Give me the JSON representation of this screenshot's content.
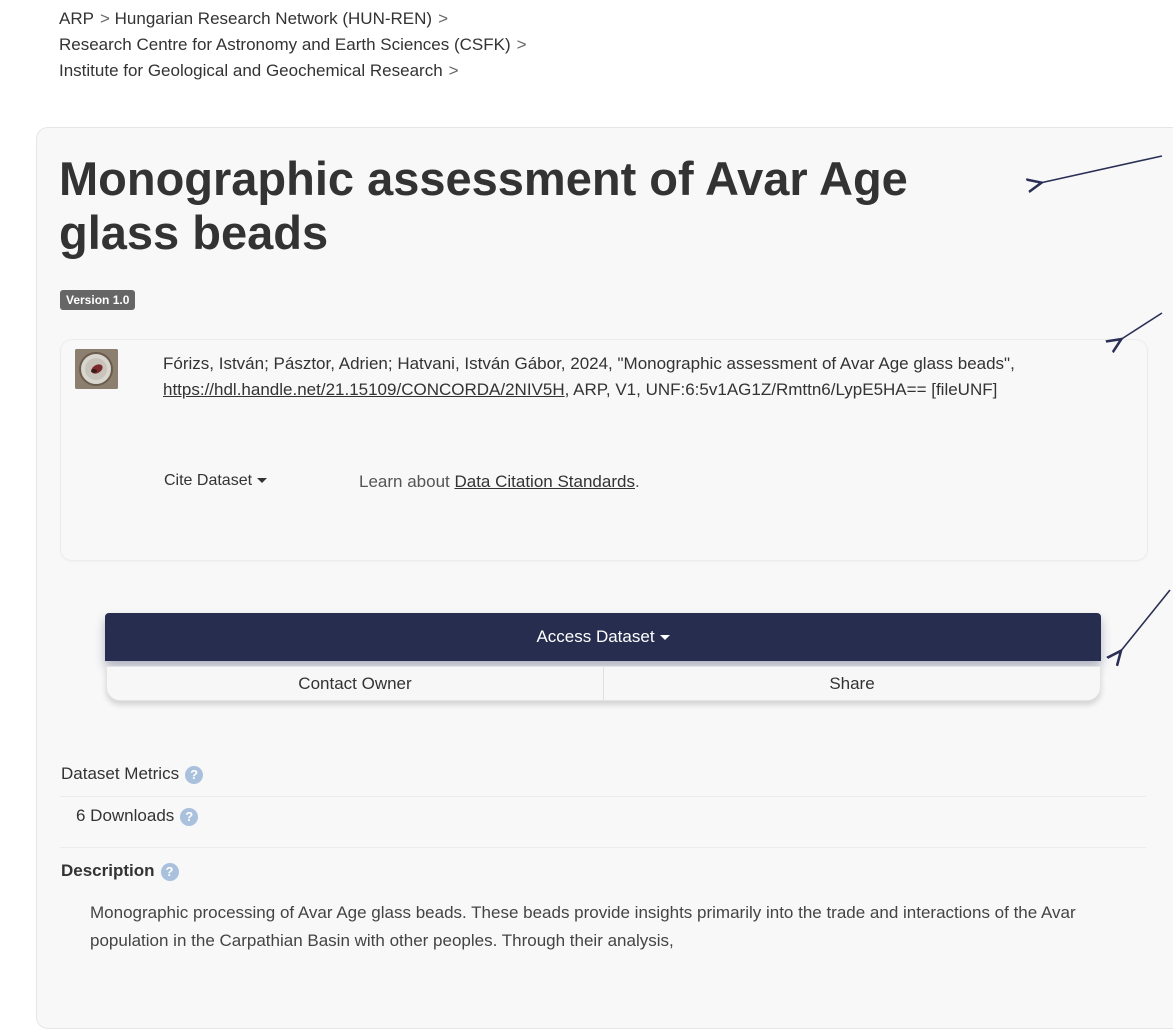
{
  "breadcrumb": {
    "items": [
      "ARP",
      "Hungarian Research Network (HUN-REN)",
      "Research Centre for Astronomy and Earth Sciences (CSFK)",
      "Institute for Geological and Geochemical Research"
    ],
    "separator": ">"
  },
  "dataset": {
    "title": "Monographic assessment of Avar Age glass beads",
    "version_badge": "Version 1.0"
  },
  "citation": {
    "prefix": "Fórizs, István; Pásztor, Adrien; Hatvani, István Gábor, 2024, \"Monographic assessment of Avar Age glass beads\", ",
    "link": "https://hdl.handle.net/21.15109/CONCORDA/2NIV5H",
    "suffix": ", ARP, V1, UNF:6:5v1AG1Z/Rmttn6/LypE5HA== [fileUNF]",
    "cite_button": "Cite Dataset",
    "learn_prefix": "Learn about ",
    "learn_link": "Data Citation Standards",
    "learn_suffix": "."
  },
  "actions": {
    "access": "Access Dataset",
    "contact": "Contact Owner",
    "share": "Share"
  },
  "metrics": {
    "label": "Dataset Metrics",
    "downloads": "6 Downloads"
  },
  "description": {
    "label": "Description",
    "text": "Monographic processing of Avar Age glass beads. These beads provide insights primarily into the trade and interactions of the Avar population in the Carpathian Basin with other peoples. Through their analysis,"
  },
  "colors": {
    "primary_button": "#262d4e",
    "badge": "#666666",
    "help_icon": "#a9c1dc"
  }
}
